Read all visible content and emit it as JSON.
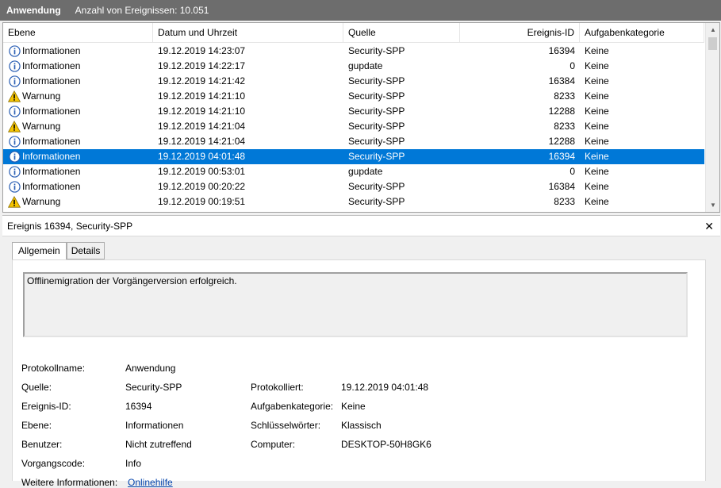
{
  "titlebar": {
    "app": "Anwendung",
    "count": "Anzahl von Ereignissen: 10.051"
  },
  "columns": [
    "Ebene",
    "Datum und Uhrzeit",
    "Quelle",
    "Ereignis-ID",
    "Aufgabenkategorie"
  ],
  "rows": [
    {
      "level": "Informationen",
      "icon": "info-icon",
      "date": "19.12.2019 14:23:07",
      "source": "Security-SPP",
      "id": "16394",
      "category": "Keine",
      "selected": false
    },
    {
      "level": "Informationen",
      "icon": "info-icon",
      "date": "19.12.2019 14:22:17",
      "source": "gupdate",
      "id": "0",
      "category": "Keine",
      "selected": false
    },
    {
      "level": "Informationen",
      "icon": "info-icon",
      "date": "19.12.2019 14:21:42",
      "source": "Security-SPP",
      "id": "16384",
      "category": "Keine",
      "selected": false
    },
    {
      "level": "Warnung",
      "icon": "warning-icon",
      "date": "19.12.2019 14:21:10",
      "source": "Security-SPP",
      "id": "8233",
      "category": "Keine",
      "selected": false
    },
    {
      "level": "Informationen",
      "icon": "info-icon",
      "date": "19.12.2019 14:21:10",
      "source": "Security-SPP",
      "id": "12288",
      "category": "Keine",
      "selected": false
    },
    {
      "level": "Warnung",
      "icon": "warning-icon",
      "date": "19.12.2019 14:21:04",
      "source": "Security-SPP",
      "id": "8233",
      "category": "Keine",
      "selected": false
    },
    {
      "level": "Informationen",
      "icon": "info-icon",
      "date": "19.12.2019 14:21:04",
      "source": "Security-SPP",
      "id": "12288",
      "category": "Keine",
      "selected": false
    },
    {
      "level": "Informationen",
      "icon": "info-icon",
      "date": "19.12.2019 04:01:48",
      "source": "Security-SPP",
      "id": "16394",
      "category": "Keine",
      "selected": true
    },
    {
      "level": "Informationen",
      "icon": "info-icon",
      "date": "19.12.2019 00:53:01",
      "source": "gupdate",
      "id": "0",
      "category": "Keine",
      "selected": false
    },
    {
      "level": "Informationen",
      "icon": "info-icon",
      "date": "19.12.2019 00:20:22",
      "source": "Security-SPP",
      "id": "16384",
      "category": "Keine",
      "selected": false
    },
    {
      "level": "Warnung",
      "icon": "warning-icon",
      "date": "19.12.2019 00:19:51",
      "source": "Security-SPP",
      "id": "8233",
      "category": "Keine",
      "selected": false
    }
  ],
  "detail": {
    "header": "Ereignis 16394, Security-SPP",
    "close": "✕",
    "tabs": [
      "Allgemein",
      "Details"
    ],
    "message": "Offlinemigration der Vorgängerversion erfolgreich.",
    "labels": {
      "protokollname": "Protokollname:",
      "quelle": "Quelle:",
      "ereignis_id": "Ereignis-ID:",
      "ebene": "Ebene:",
      "benutzer": "Benutzer:",
      "vorgangscode": "Vorgangscode:",
      "weitere": "Weitere Informationen:",
      "protokolliert": "Protokolliert:",
      "aufgabenkategorie": "Aufgabenkategorie:",
      "schluesselwoerter": "Schlüsselwörter:",
      "computer": "Computer:"
    },
    "values": {
      "protokollname": "Anwendung",
      "quelle": "Security-SPP",
      "ereignis_id": "16394",
      "ebene": "Informationen",
      "benutzer": "Nicht zutreffend",
      "vorgangscode": "Info",
      "weitere": "Onlinehilfe",
      "protokolliert": "19.12.2019 04:01:48",
      "aufgabenkategorie": "Keine",
      "schluesselwoerter": "Klassisch",
      "computer": "DESKTOP-50H8GK6"
    }
  },
  "colors": {
    "selection": "#0078d7",
    "titlebar": "#6d6d6d",
    "link": "#0645ad",
    "info": "#2b5fb4",
    "warning": "#f5c400"
  }
}
